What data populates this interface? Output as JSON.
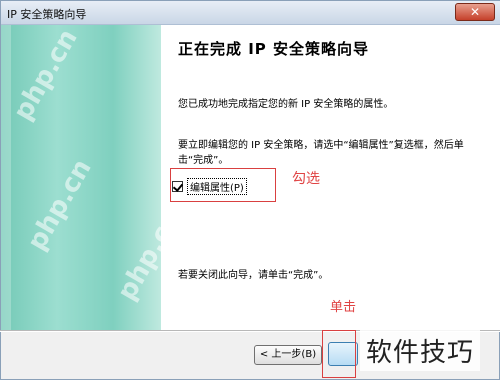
{
  "window": {
    "title": "IP 安全策略向导",
    "close_glyph": "✕"
  },
  "wizard": {
    "title": "正在完成 IP 安全策略向导",
    "paragraph1": "您已成功地完成指定您的新 IP 安全策略的属性。",
    "paragraph2": "要立即编辑您的 IP 安全策略，请选中“编辑属性”复选框，然后单击“完成”。",
    "checkbox": {
      "label": "编辑属性(P)",
      "checked": true
    },
    "paragraph3": "若要关闭此向导，请单击“完成”。"
  },
  "buttons": {
    "back_label": "< 上一步(B)",
    "finish_label": ""
  },
  "annotations": {
    "check_note": "勾选",
    "click_note": "单击",
    "color": "#e04444"
  },
  "watermarks": {
    "brand": "软件技巧",
    "site": "php.cn"
  },
  "colors": {
    "side_panel": "#7fd0bf",
    "title_bar": "#c9d6e6"
  }
}
